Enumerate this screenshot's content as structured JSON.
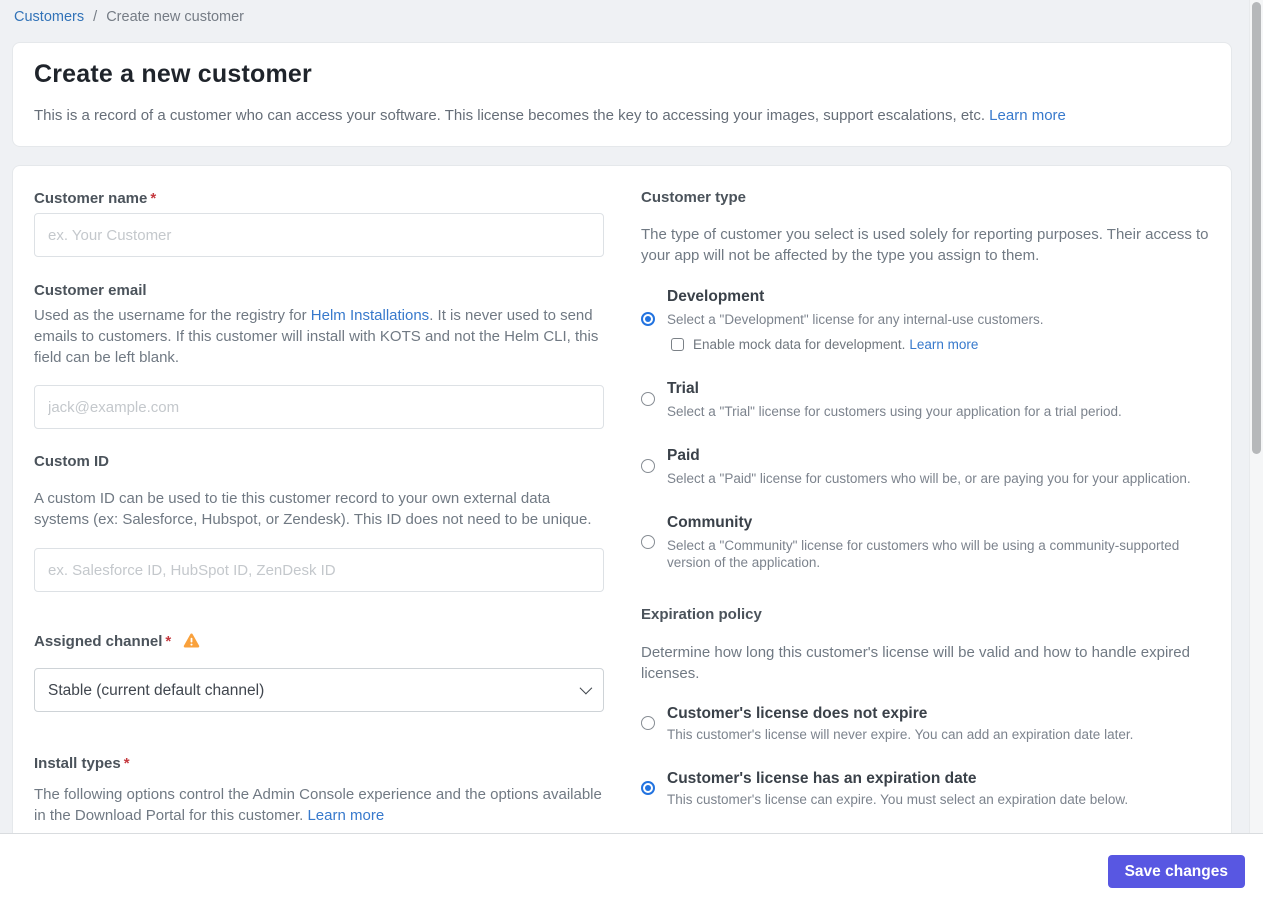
{
  "breadcrumb": {
    "link": "Customers",
    "separator": "/",
    "current": "Create new customer"
  },
  "header": {
    "title": "Create a new customer",
    "description": "This is a record of a customer who can access your software. This license becomes the key to accessing your images, support escalations, etc.",
    "learn_more": "Learn more"
  },
  "form": {
    "customer_name": {
      "label": "Customer name",
      "required": "*",
      "placeholder": "ex. Your Customer",
      "value": ""
    },
    "customer_email": {
      "label": "Customer email",
      "description_before_link": "Used as the username for the registry for ",
      "link": "Helm Installations",
      "description_after_link": ". It is never used to send emails to customers. If this customer will install with KOTS and not the Helm CLI, this field can be left blank.",
      "placeholder": "jack@example.com",
      "value": ""
    },
    "custom_id": {
      "label": "Custom ID",
      "description": "A custom ID can be used to tie this customer record to your own external data systems (ex: Salesforce, Hubspot, or Zendesk). This ID does not need to be unique.",
      "placeholder": "ex. Salesforce ID, HubSpot ID, ZenDesk ID",
      "value": ""
    },
    "assigned_channel": {
      "label": "Assigned channel",
      "required": "*",
      "selected_option": "Stable (current default channel)",
      "warning_icon": "warning-triangle"
    },
    "install_types": {
      "label": "Install types",
      "required": "*",
      "description": "The following options control the Admin Console experience and the options available in the Download Portal for this customer.",
      "learn_more": "Learn more"
    },
    "customer_type": {
      "label": "Customer type",
      "description": "The type of customer you select is used solely for reporting purposes. Their access to your app will not be affected by the type you assign to them.",
      "options": [
        {
          "title": "Development",
          "description": "Select a \"Development\" license for any internal-use customers.",
          "selected": true,
          "checkbox_label": "Enable mock data for development.",
          "checkbox_learn_more": "Learn more",
          "checkbox_checked": false
        },
        {
          "title": "Trial",
          "description": "Select a \"Trial\" license for customers using your application for a trial period.",
          "selected": false
        },
        {
          "title": "Paid",
          "description": "Select a \"Paid\" license for customers who will be, or are paying you for your application.",
          "selected": false
        },
        {
          "title": "Community",
          "description": "Select a \"Community\" license for customers who will be using a community-supported version of the application.",
          "selected": false
        }
      ]
    },
    "expiration_policy": {
      "label": "Expiration policy",
      "description": "Determine how long this customer's license will be valid and how to handle expired licenses.",
      "options": [
        {
          "title": "Customer's license does not expire",
          "description": "This customer's license will never expire. You can add an expiration date later.",
          "selected": false
        },
        {
          "title": "Customer's license has an expiration date",
          "description": "This customer's license can expire. You must select an expiration date below.",
          "selected": true
        }
      ]
    }
  },
  "footer": {
    "save_label": "Save changes"
  },
  "colors": {
    "page_background": "#eff1f4",
    "card_background": "#ffffff",
    "link": "#3779cc",
    "accent_radio": "#2273e0",
    "save_button": "#5857e2",
    "warning": "#f9a13c",
    "required_asterisk": "#c5393f"
  }
}
